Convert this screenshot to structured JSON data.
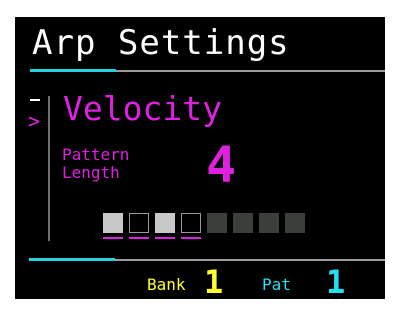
{
  "screen": {
    "title": "Arp Settings",
    "param": {
      "name": "Velocity",
      "field_label_line1": "Pattern",
      "field_label_line2": "Length",
      "field_value": "4"
    },
    "steps": [
      {
        "state": "active",
        "marked": true
      },
      {
        "state": "inactive",
        "marked": true
      },
      {
        "state": "active",
        "marked": true
      },
      {
        "state": "inactive",
        "marked": true
      },
      {
        "state": "off",
        "marked": false
      },
      {
        "state": "off",
        "marked": false
      },
      {
        "state": "off",
        "marked": false
      },
      {
        "state": "off",
        "marked": false
      }
    ],
    "footer": {
      "bank_label": "Bank",
      "bank_value": "1",
      "pat_label": "Pat",
      "pat_value": "1"
    }
  },
  "colors": {
    "background": "#000000",
    "title": "#ffffff",
    "param": "#e020e0",
    "accent_cyan": "#25d0e4",
    "bank": "#ffff2a",
    "pat": "#25e0f0"
  },
  "icons": {
    "selection_indicator": "chevron-right-icon"
  }
}
